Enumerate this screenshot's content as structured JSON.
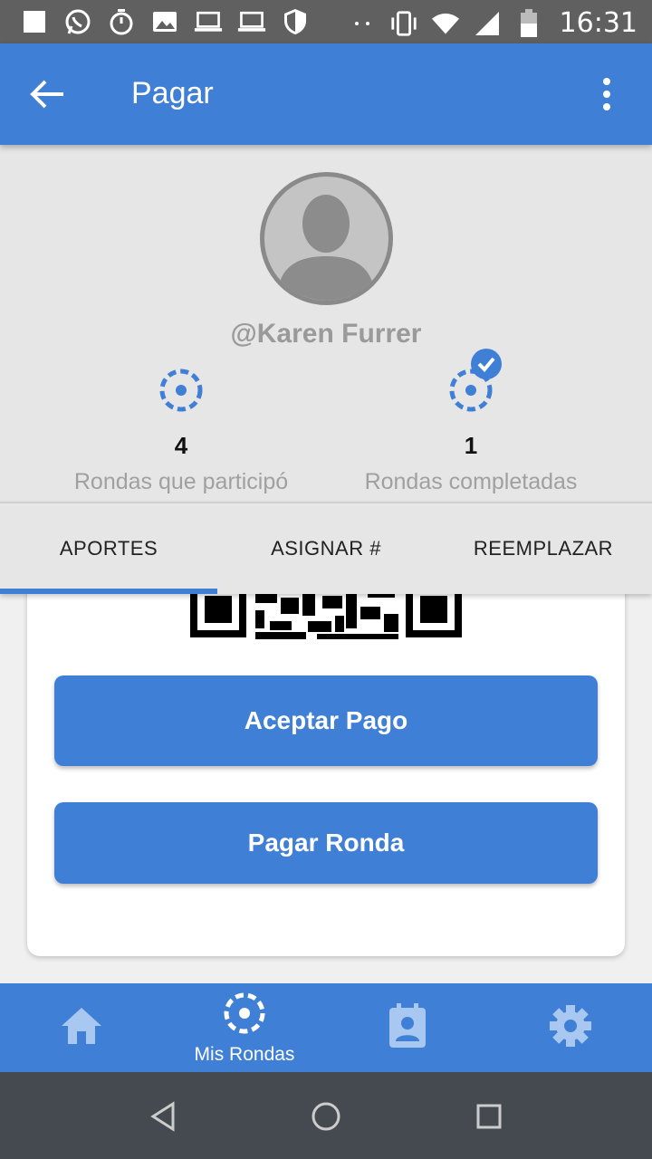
{
  "status_bar": {
    "time": "16:31",
    "icons": [
      "square-notification-icon",
      "whatsapp-icon",
      "stopwatch-icon",
      "image-icon",
      "laptop-icon",
      "laptop-icon",
      "shield-icon",
      "dots-icon",
      "vibrate-icon",
      "wifi-icon",
      "signal-icon",
      "battery-icon"
    ]
  },
  "app_bar": {
    "title": "Pagar",
    "back_icon": "arrow-back-icon",
    "menu_icon": "more-vert-icon",
    "color": "#3f7fd6"
  },
  "profile": {
    "username": "@Karen Furrer",
    "stats": [
      {
        "value": "4",
        "label": "Rondas que participó",
        "icon": "rondas-icon"
      },
      {
        "value": "1",
        "label": "Rondas completadas",
        "icon": "rondas-check-icon"
      }
    ]
  },
  "tabs": {
    "items": [
      "APORTES",
      "ASIGNAR #",
      "REEMPLAZAR"
    ],
    "selected": "APORTES"
  },
  "card": {
    "qr_icon": "qr-code-icon",
    "buttons": {
      "accept": "Aceptar Pago",
      "pay": "Pagar Ronda"
    }
  },
  "bottom_nav": {
    "items": [
      {
        "icon": "home-icon",
        "label": ""
      },
      {
        "icon": "rondas-icon",
        "label": "Mis Rondas"
      },
      {
        "icon": "contact-calendar-icon",
        "label": ""
      },
      {
        "icon": "settings-icon",
        "label": ""
      }
    ],
    "selected": "Mis Rondas"
  },
  "system_nav": {
    "icons": [
      "back-triangle-icon",
      "home-circle-icon",
      "recents-square-icon"
    ]
  }
}
